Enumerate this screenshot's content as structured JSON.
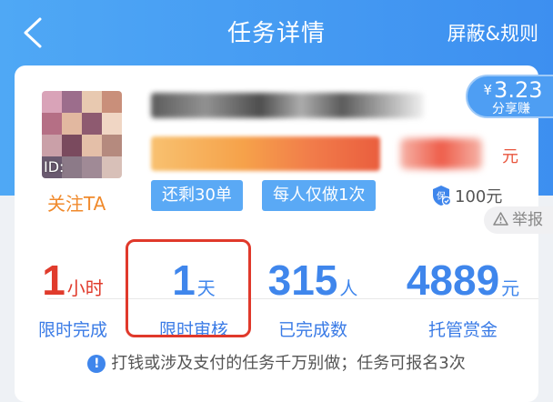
{
  "header": {
    "title": "任务详情",
    "right_link": "屏蔽&规则"
  },
  "task": {
    "follow_label": "关注TA",
    "avatar_id_prefix": "ID:",
    "tags": [
      "还剩30单",
      "每人仅做1次"
    ],
    "price_unit": "元",
    "deposit": "100元",
    "deposit_icon": "shield-icon"
  },
  "share": {
    "currency": "¥",
    "amount": "3.23",
    "label": "分享赚"
  },
  "report": {
    "label": "举报"
  },
  "stats": [
    {
      "value": "1",
      "unit": "小时",
      "label": "限时完成",
      "color": "#e03b2c"
    },
    {
      "value": "1",
      "unit": "天",
      "label": "限时审核",
      "color": "#3f86ec"
    },
    {
      "value": "315",
      "unit": "人",
      "label": "已完成数",
      "color": "#3f86ec"
    },
    {
      "value": "4889",
      "unit": "元",
      "label": "托管赏金",
      "color": "#3f86ec"
    }
  ],
  "notice": {
    "icon": "!",
    "text": "打钱或涉及支付的任务千万别做；任务可报名3次"
  },
  "colors": {
    "header_blue": "#4fa8f5",
    "accent_red": "#e03b2c",
    "accent_blue": "#3f86ec",
    "follow_orange": "#f08a2c"
  }
}
